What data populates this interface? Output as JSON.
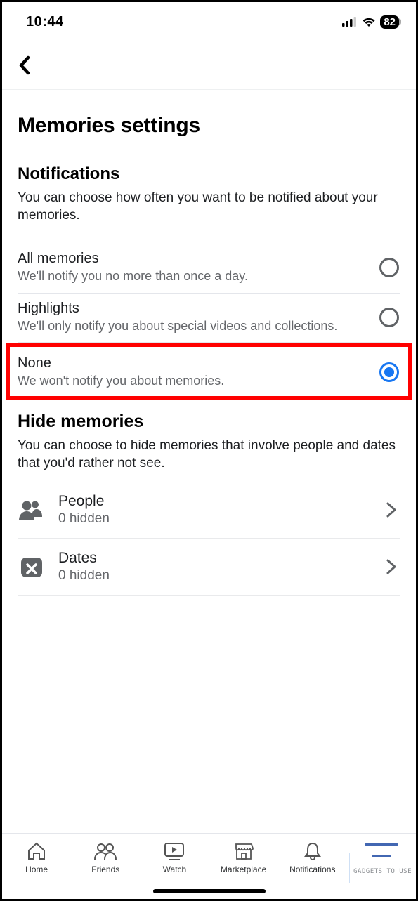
{
  "status": {
    "time": "10:44",
    "battery": "82"
  },
  "page": {
    "title": "Memories settings"
  },
  "notifications": {
    "title": "Notifications",
    "desc": "You can choose how often you want to be notified about your memories.",
    "options": [
      {
        "title": "All memories",
        "sub": "We'll notify you no more than once a day.",
        "selected": false
      },
      {
        "title": "Highlights",
        "sub": "We'll only notify you about special videos and collections.",
        "selected": false
      },
      {
        "title": "None",
        "sub": "We won't notify you about memories.",
        "selected": true
      }
    ]
  },
  "hide": {
    "title": "Hide memories",
    "desc": "You can choose to hide memories that involve people and dates that you'd rather not see.",
    "items": [
      {
        "title": "People",
        "sub": "0 hidden"
      },
      {
        "title": "Dates",
        "sub": "0 hidden"
      }
    ]
  },
  "tabs": {
    "home": "Home",
    "friends": "Friends",
    "watch": "Watch",
    "marketplace": "Marketplace",
    "notifications": "Notifications"
  },
  "watermark": "GADGETS TO USE"
}
